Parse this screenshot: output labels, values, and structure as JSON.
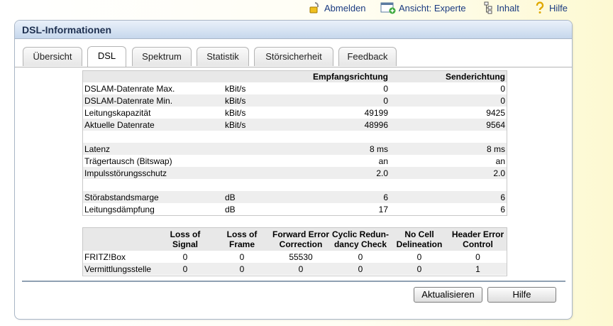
{
  "topnav": {
    "logout": "Abmelden",
    "view": "Ansicht: Experte",
    "contents": "Inhalt",
    "help": "Hilfe"
  },
  "panel": {
    "title": "DSL-Informationen"
  },
  "tabs": [
    {
      "label": "Übersicht",
      "active": false
    },
    {
      "label": "DSL",
      "active": true
    },
    {
      "label": "Spektrum",
      "active": false
    },
    {
      "label": "Statistik",
      "active": false
    },
    {
      "label": "Störsicherheit",
      "active": false
    },
    {
      "label": "Feedback",
      "active": false
    }
  ],
  "dsl_table": {
    "headers": {
      "rx": "Empfangsrichtung",
      "tx": "Senderichtung"
    },
    "rows": [
      {
        "label": "DSLAM-Datenrate Max.",
        "unit": "kBit/s",
        "rx": "0",
        "tx": "0"
      },
      {
        "label": "DSLAM-Datenrate Min.",
        "unit": "kBit/s",
        "rx": "0",
        "tx": "0"
      },
      {
        "label": "Leitungskapazität",
        "unit": "kBit/s",
        "rx": "49199",
        "tx": "9425"
      },
      {
        "label": "Aktuelle Datenrate",
        "unit": "kBit/s",
        "rx": "48996",
        "tx": "9564"
      },
      {
        "label": "Latenz",
        "unit": "",
        "rx": "8 ms",
        "tx": "8 ms"
      },
      {
        "label": "Trägertausch (Bitswap)",
        "unit": "",
        "rx": "an",
        "tx": "an"
      },
      {
        "label": "Impulsstörungsschutz",
        "unit": "",
        "rx": "2.0",
        "tx": "2.0"
      },
      {
        "label": "Störabstandsmarge",
        "unit": "dB",
        "rx": "6",
        "tx": "6"
      },
      {
        "label": "Leitungsdämpfung",
        "unit": "dB",
        "rx": "17",
        "tx": "6"
      }
    ]
  },
  "error_table": {
    "headers": [
      [
        "Loss of",
        "Signal"
      ],
      [
        "Loss of",
        "Frame"
      ],
      [
        "Forward Error",
        "Correction"
      ],
      [
        "Cyclic Redun-",
        "dancy Check"
      ],
      [
        "No Cell",
        "Delineation"
      ],
      [
        "Header Error",
        "Control"
      ]
    ],
    "rows": [
      {
        "label": "FRITZ!Box",
        "values": [
          "0",
          "0",
          "55530",
          "0",
          "0",
          "0"
        ]
      },
      {
        "label": "Vermittlungsstelle",
        "values": [
          "0",
          "0",
          "0",
          "0",
          "0",
          "1"
        ]
      }
    ]
  },
  "buttons": {
    "refresh": "Aktualisieren",
    "help": "Hilfe"
  }
}
